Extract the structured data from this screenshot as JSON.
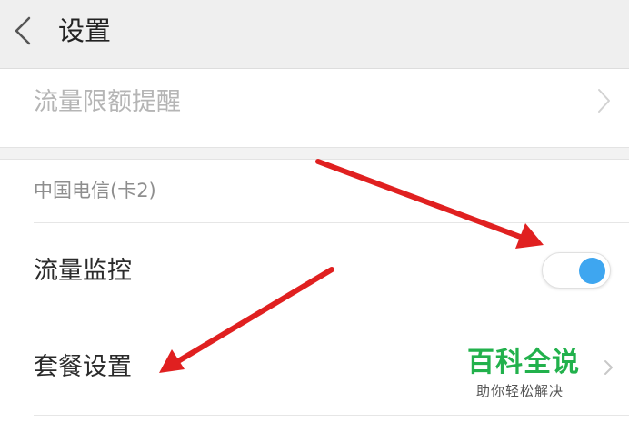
{
  "header": {
    "title": "设置",
    "back_icon": "chevron-left-icon"
  },
  "rows": {
    "data_limit_reminder": {
      "label": "流量限额提醒",
      "enabled": false,
      "chevron_icon": "chevron-right-icon"
    },
    "sim_section": {
      "label": "中国电信(卡2)"
    },
    "data_monitor": {
      "label": "流量监控",
      "toggle_on": true
    },
    "plan_settings": {
      "label": "套餐设置",
      "chevron_icon": "chevron-right-icon"
    }
  },
  "watermark": {
    "title": "百科全说",
    "subtitle": "助你轻松解决"
  },
  "annotations": {
    "arrow_color": "#e02020",
    "arrows": [
      "arrow-to-toggle",
      "arrow-to-plan-settings"
    ]
  },
  "colors": {
    "header_bg": "#efefef",
    "toggle_knob": "#3ea6f0",
    "watermark_green": "#22b14c"
  }
}
